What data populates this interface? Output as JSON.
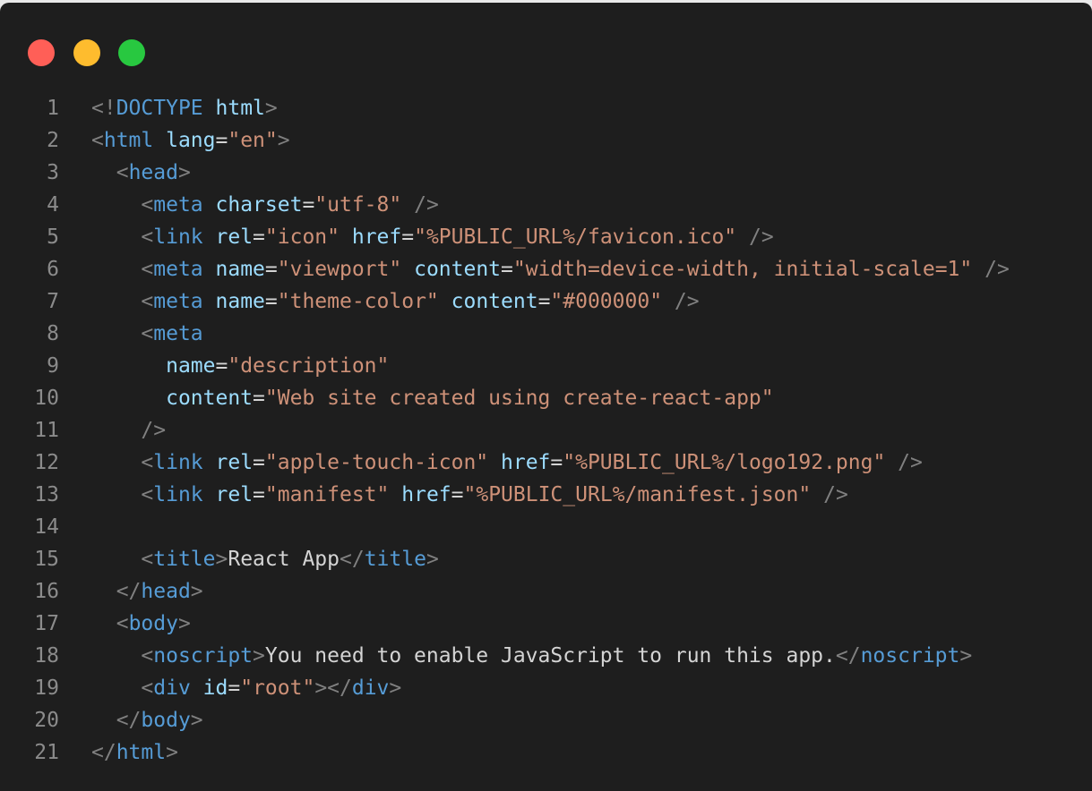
{
  "window": {
    "controls": [
      {
        "name": "close-button",
        "color": "#ff5f57"
      },
      {
        "name": "minimize-button",
        "color": "#febc2e"
      },
      {
        "name": "zoom-button",
        "color": "#28c840"
      }
    ]
  },
  "colors": {
    "background": "#1e1e1e",
    "line_number": "#8b8b8b",
    "punctuation": "#808080",
    "tag": "#569cd6",
    "attribute": "#9cdcfe",
    "string": "#ce9178",
    "text": "#d4d4d4"
  },
  "code": {
    "lines": [
      {
        "n": "1",
        "indent": "",
        "tokens": [
          {
            "c": "p",
            "t": "<!"
          },
          {
            "c": "t",
            "t": "DOCTYPE"
          },
          {
            "c": "x",
            "t": " "
          },
          {
            "c": "a",
            "t": "html"
          },
          {
            "c": "p",
            "t": ">"
          }
        ]
      },
      {
        "n": "2",
        "indent": "",
        "tokens": [
          {
            "c": "p",
            "t": "<"
          },
          {
            "c": "t",
            "t": "html"
          },
          {
            "c": "x",
            "t": " "
          },
          {
            "c": "a",
            "t": "lang"
          },
          {
            "c": "x",
            "t": "="
          },
          {
            "c": "v",
            "t": "\"en\""
          },
          {
            "c": "p",
            "t": ">"
          }
        ]
      },
      {
        "n": "3",
        "indent": "  ",
        "tokens": [
          {
            "c": "p",
            "t": "<"
          },
          {
            "c": "t",
            "t": "head"
          },
          {
            "c": "p",
            "t": ">"
          }
        ]
      },
      {
        "n": "4",
        "indent": "    ",
        "tokens": [
          {
            "c": "p",
            "t": "<"
          },
          {
            "c": "t",
            "t": "meta"
          },
          {
            "c": "x",
            "t": " "
          },
          {
            "c": "a",
            "t": "charset"
          },
          {
            "c": "x",
            "t": "="
          },
          {
            "c": "v",
            "t": "\"utf-8\""
          },
          {
            "c": "x",
            "t": " "
          },
          {
            "c": "p",
            "t": "/>"
          }
        ]
      },
      {
        "n": "5",
        "indent": "    ",
        "tokens": [
          {
            "c": "p",
            "t": "<"
          },
          {
            "c": "t",
            "t": "link"
          },
          {
            "c": "x",
            "t": " "
          },
          {
            "c": "a",
            "t": "rel"
          },
          {
            "c": "x",
            "t": "="
          },
          {
            "c": "v",
            "t": "\"icon\""
          },
          {
            "c": "x",
            "t": " "
          },
          {
            "c": "a",
            "t": "href"
          },
          {
            "c": "x",
            "t": "="
          },
          {
            "c": "v",
            "t": "\"%PUBLIC_URL%/favicon.ico\""
          },
          {
            "c": "x",
            "t": " "
          },
          {
            "c": "p",
            "t": "/>"
          }
        ]
      },
      {
        "n": "6",
        "indent": "    ",
        "tokens": [
          {
            "c": "p",
            "t": "<"
          },
          {
            "c": "t",
            "t": "meta"
          },
          {
            "c": "x",
            "t": " "
          },
          {
            "c": "a",
            "t": "name"
          },
          {
            "c": "x",
            "t": "="
          },
          {
            "c": "v",
            "t": "\"viewport\""
          },
          {
            "c": "x",
            "t": " "
          },
          {
            "c": "a",
            "t": "content"
          },
          {
            "c": "x",
            "t": "="
          },
          {
            "c": "v",
            "t": "\"width=device-width, initial-scale=1\""
          },
          {
            "c": "x",
            "t": " "
          },
          {
            "c": "p",
            "t": "/>"
          }
        ]
      },
      {
        "n": "7",
        "indent": "    ",
        "tokens": [
          {
            "c": "p",
            "t": "<"
          },
          {
            "c": "t",
            "t": "meta"
          },
          {
            "c": "x",
            "t": " "
          },
          {
            "c": "a",
            "t": "name"
          },
          {
            "c": "x",
            "t": "="
          },
          {
            "c": "v",
            "t": "\"theme-color\""
          },
          {
            "c": "x",
            "t": " "
          },
          {
            "c": "a",
            "t": "content"
          },
          {
            "c": "x",
            "t": "="
          },
          {
            "c": "v",
            "t": "\"#000000\""
          },
          {
            "c": "x",
            "t": " "
          },
          {
            "c": "p",
            "t": "/>"
          }
        ]
      },
      {
        "n": "8",
        "indent": "    ",
        "tokens": [
          {
            "c": "p",
            "t": "<"
          },
          {
            "c": "t",
            "t": "meta"
          }
        ]
      },
      {
        "n": "9",
        "indent": "      ",
        "tokens": [
          {
            "c": "a",
            "t": "name"
          },
          {
            "c": "x",
            "t": "="
          },
          {
            "c": "v",
            "t": "\"description\""
          }
        ]
      },
      {
        "n": "10",
        "indent": "      ",
        "tokens": [
          {
            "c": "a",
            "t": "content"
          },
          {
            "c": "x",
            "t": "="
          },
          {
            "c": "v",
            "t": "\"Web site created using create-react-app\""
          }
        ]
      },
      {
        "n": "11",
        "indent": "    ",
        "tokens": [
          {
            "c": "p",
            "t": "/>"
          }
        ]
      },
      {
        "n": "12",
        "indent": "    ",
        "tokens": [
          {
            "c": "p",
            "t": "<"
          },
          {
            "c": "t",
            "t": "link"
          },
          {
            "c": "x",
            "t": " "
          },
          {
            "c": "a",
            "t": "rel"
          },
          {
            "c": "x",
            "t": "="
          },
          {
            "c": "v",
            "t": "\"apple-touch-icon\""
          },
          {
            "c": "x",
            "t": " "
          },
          {
            "c": "a",
            "t": "href"
          },
          {
            "c": "x",
            "t": "="
          },
          {
            "c": "v",
            "t": "\"%PUBLIC_URL%/logo192.png\""
          },
          {
            "c": "x",
            "t": " "
          },
          {
            "c": "p",
            "t": "/>"
          }
        ]
      },
      {
        "n": "13",
        "indent": "    ",
        "tokens": [
          {
            "c": "p",
            "t": "<"
          },
          {
            "c": "t",
            "t": "link"
          },
          {
            "c": "x",
            "t": " "
          },
          {
            "c": "a",
            "t": "rel"
          },
          {
            "c": "x",
            "t": "="
          },
          {
            "c": "v",
            "t": "\"manifest\""
          },
          {
            "c": "x",
            "t": " "
          },
          {
            "c": "a",
            "t": "href"
          },
          {
            "c": "x",
            "t": "="
          },
          {
            "c": "v",
            "t": "\"%PUBLIC_URL%/manifest.json\""
          },
          {
            "c": "x",
            "t": " "
          },
          {
            "c": "p",
            "t": "/>"
          }
        ]
      },
      {
        "n": "14",
        "indent": "",
        "tokens": []
      },
      {
        "n": "15",
        "indent": "    ",
        "tokens": [
          {
            "c": "p",
            "t": "<"
          },
          {
            "c": "t",
            "t": "title"
          },
          {
            "c": "p",
            "t": ">"
          },
          {
            "c": "x",
            "t": "React App"
          },
          {
            "c": "p",
            "t": "</"
          },
          {
            "c": "t",
            "t": "title"
          },
          {
            "c": "p",
            "t": ">"
          }
        ]
      },
      {
        "n": "16",
        "indent": "  ",
        "tokens": [
          {
            "c": "p",
            "t": "</"
          },
          {
            "c": "t",
            "t": "head"
          },
          {
            "c": "p",
            "t": ">"
          }
        ]
      },
      {
        "n": "17",
        "indent": "  ",
        "tokens": [
          {
            "c": "p",
            "t": "<"
          },
          {
            "c": "t",
            "t": "body"
          },
          {
            "c": "p",
            "t": ">"
          }
        ]
      },
      {
        "n": "18",
        "indent": "    ",
        "tokens": [
          {
            "c": "p",
            "t": "<"
          },
          {
            "c": "t",
            "t": "noscript"
          },
          {
            "c": "p",
            "t": ">"
          },
          {
            "c": "x",
            "t": "You need to enable JavaScript to run this app."
          },
          {
            "c": "p",
            "t": "</"
          },
          {
            "c": "t",
            "t": "noscript"
          },
          {
            "c": "p",
            "t": ">"
          }
        ]
      },
      {
        "n": "19",
        "indent": "    ",
        "tokens": [
          {
            "c": "p",
            "t": "<"
          },
          {
            "c": "t",
            "t": "div"
          },
          {
            "c": "x",
            "t": " "
          },
          {
            "c": "a",
            "t": "id"
          },
          {
            "c": "x",
            "t": "="
          },
          {
            "c": "v",
            "t": "\"root\""
          },
          {
            "c": "p",
            "t": "></"
          },
          {
            "c": "t",
            "t": "div"
          },
          {
            "c": "p",
            "t": ">"
          }
        ]
      },
      {
        "n": "20",
        "indent": "  ",
        "tokens": [
          {
            "c": "p",
            "t": "</"
          },
          {
            "c": "t",
            "t": "body"
          },
          {
            "c": "p",
            "t": ">"
          }
        ]
      },
      {
        "n": "21",
        "indent": "",
        "tokens": [
          {
            "c": "p",
            "t": "</"
          },
          {
            "c": "t",
            "t": "html"
          },
          {
            "c": "p",
            "t": ">"
          }
        ]
      }
    ]
  }
}
